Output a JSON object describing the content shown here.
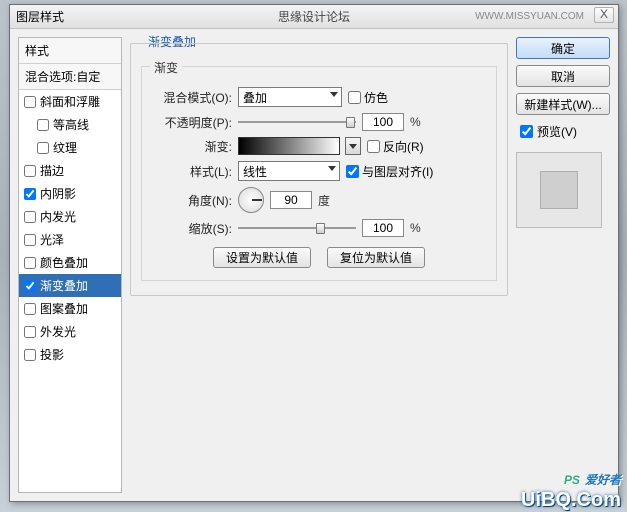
{
  "title": "图层样式",
  "brand": "思缘设计论坛",
  "brand_url": "WWW.MISSYUAN.COM",
  "close": "X",
  "styles_header": "样式",
  "blend_options": "混合选项:自定",
  "style_items": [
    {
      "label": "斜面和浮雕",
      "checked": false,
      "sub": false
    },
    {
      "label": "等高线",
      "checked": false,
      "sub": true
    },
    {
      "label": "纹理",
      "checked": false,
      "sub": true
    },
    {
      "label": "描边",
      "checked": false,
      "sub": false
    },
    {
      "label": "内阴影",
      "checked": true,
      "sub": false
    },
    {
      "label": "内发光",
      "checked": false,
      "sub": false
    },
    {
      "label": "光泽",
      "checked": false,
      "sub": false
    },
    {
      "label": "颜色叠加",
      "checked": false,
      "sub": false
    },
    {
      "label": "渐变叠加",
      "checked": true,
      "sub": false,
      "selected": true
    },
    {
      "label": "图案叠加",
      "checked": false,
      "sub": false
    },
    {
      "label": "外发光",
      "checked": false,
      "sub": false
    },
    {
      "label": "投影",
      "checked": false,
      "sub": false
    }
  ],
  "section_title": "渐变叠加",
  "group_title": "渐变",
  "labels": {
    "blend_mode": "混合模式(O):",
    "opacity": "不透明度(P):",
    "gradient": "渐变:",
    "style": "样式(L):",
    "angle": "角度(N):",
    "scale": "缩放(S):"
  },
  "values": {
    "blend_mode": "叠加",
    "opacity": "100",
    "style": "线性",
    "angle": "90",
    "scale": "100"
  },
  "units": {
    "percent": "%",
    "degree": "度"
  },
  "checkboxes": {
    "dither": "仿色",
    "dither_checked": false,
    "reverse": "反向(R)",
    "reverse_checked": false,
    "align": "与图层对齐(I)",
    "align_checked": true
  },
  "buttons": {
    "set_default": "设置为默认值",
    "reset_default": "复位为默认值"
  },
  "right": {
    "ok": "确定",
    "cancel": "取消",
    "new_style": "新建样式(W)...",
    "preview": "预览(V)",
    "preview_checked": true
  },
  "watermark": {
    "line1a": "PS",
    "line1b": "爱好者",
    "line2": "UiBQ.Com"
  }
}
